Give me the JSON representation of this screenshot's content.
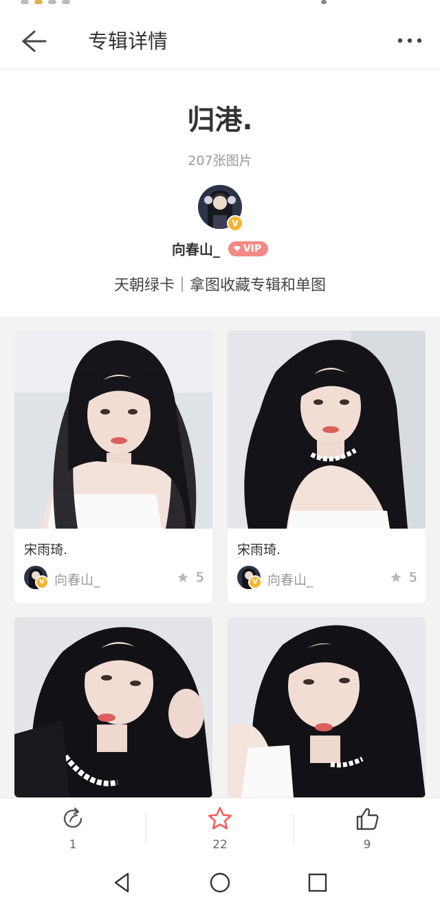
{
  "header": {
    "title": "专辑详情"
  },
  "album": {
    "title": "归港.",
    "count": "207张图片",
    "author": "向春山_",
    "vip_label": "VIP",
    "bio": "天朝绿卡｜拿图收藏专辑和单图"
  },
  "cards": [
    {
      "caption": "宋雨琦.",
      "author": "向春山_",
      "stars": "5"
    },
    {
      "caption": "宋雨琦.",
      "author": "向春山_",
      "stars": "5"
    }
  ],
  "actions": {
    "repost_count": "1",
    "favorite_count": "22",
    "like_count": "9"
  },
  "icons": {
    "back": "back-arrow-icon",
    "more": "more-dots-icon",
    "repost": "repost-icon",
    "favorite": "star-icon",
    "like": "thumbs-up-icon",
    "nav_back": "nav-back-icon",
    "nav_home": "nav-home-icon",
    "nav_recent": "nav-recent-icon"
  },
  "colors": {
    "accent_red": "#f0605a",
    "vip_pink": "#f48a86",
    "verified_gold": "#f2b636"
  }
}
